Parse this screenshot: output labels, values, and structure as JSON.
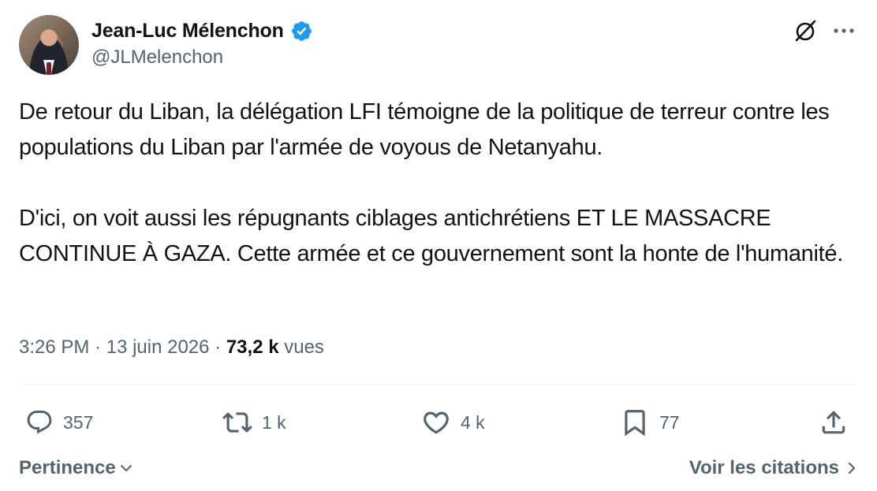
{
  "author": {
    "display_name": "Jean-Luc Mélenchon",
    "handle": "@JLMelenchon",
    "verified": true
  },
  "tweet": {
    "paragraphs": [
      "De retour du Liban, la délégation LFI témoigne de la politique de terreur contre les populations du Liban par l'armée de voyous de Netanyahu.",
      "D'ici, on voit aussi les répugnants ciblages antichrétiens ET LE MASSACRE CONTINUE À GAZA. Cette armée et ce gouvernement sont la honte de l'humanité."
    ]
  },
  "meta": {
    "time": "3:26 PM",
    "separator": " · ",
    "date": "13 juin 2026",
    "views_count": "73,2 k",
    "views_label": "vues"
  },
  "actions": {
    "replies": "357",
    "reposts": "1 k",
    "likes": "4 k",
    "bookmarks": "77"
  },
  "footer": {
    "sort_label": "Pertinence",
    "quotes_label": "Voir les citations"
  },
  "colors": {
    "text_primary": "#0f1419",
    "text_secondary": "#536471",
    "verified_blue": "#1d9bf0",
    "divider": "#eff3f4"
  },
  "icons": {
    "verified": "verified-badge-icon",
    "grok": "grok-icon",
    "more": "more-icon",
    "reply": "reply-icon",
    "repost": "repost-icon",
    "like": "heart-icon",
    "bookmark": "bookmark-icon",
    "share": "share-icon",
    "sort": "chevron-down-icon",
    "quotes": "chevron-right-icon"
  }
}
